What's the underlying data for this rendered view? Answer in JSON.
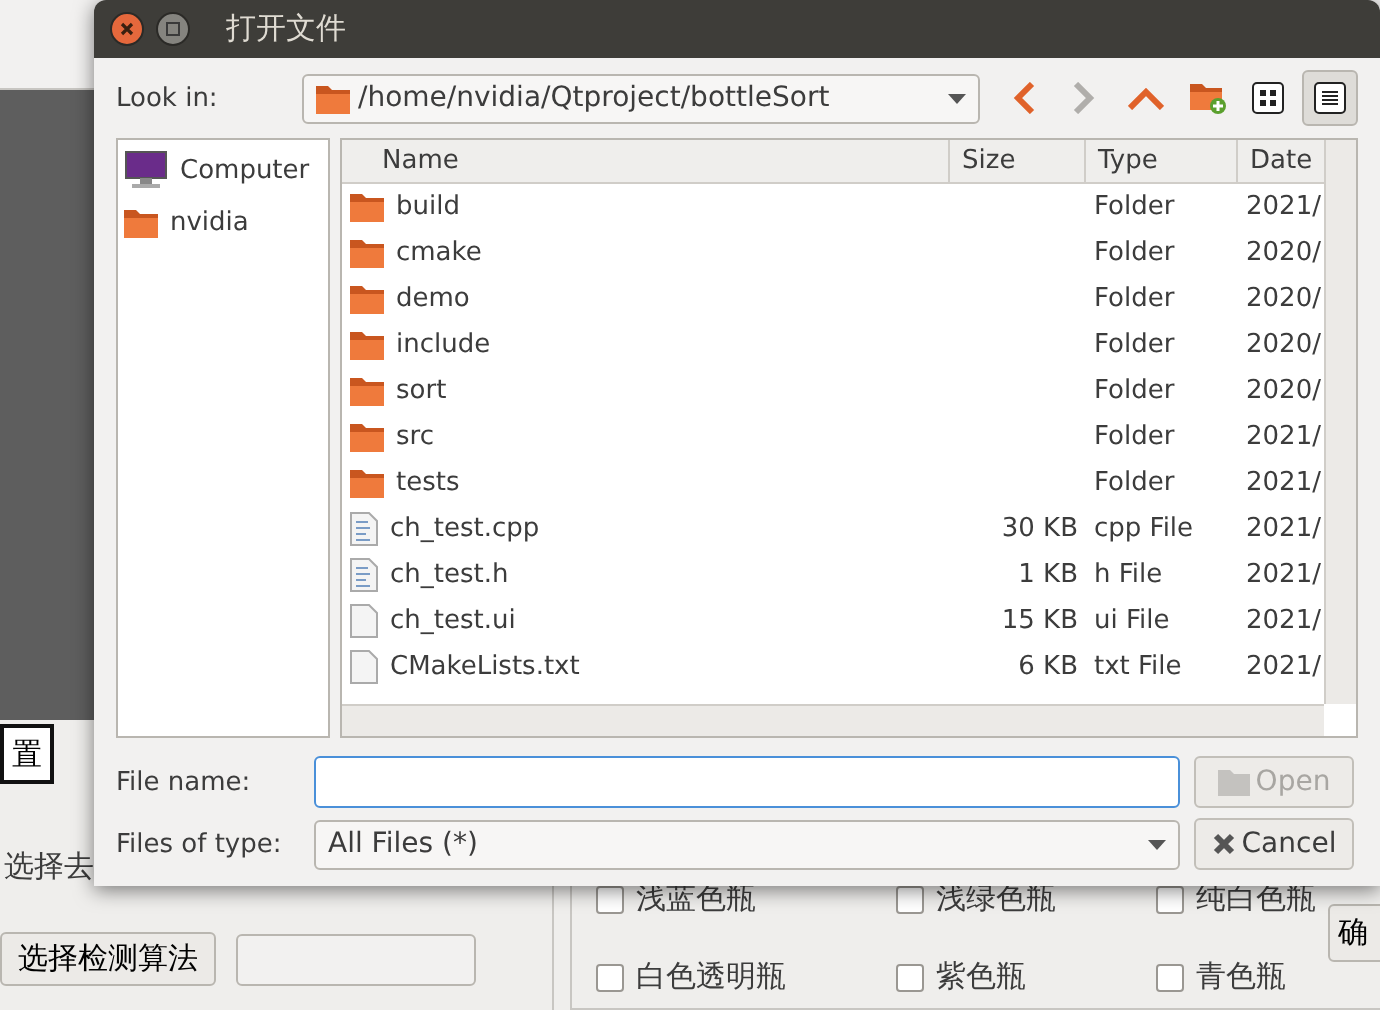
{
  "background": {
    "settings_button": "置",
    "option_label": "选择去",
    "detect_button": "选择检测算法",
    "checkboxes": [
      {
        "label": "浅蓝色瓶",
        "checked": false
      },
      {
        "label": "浅绿色瓶",
        "checked": false
      },
      {
        "label": "纯白色瓶",
        "checked": false
      },
      {
        "label": "白色透明瓶",
        "checked": false
      },
      {
        "label": "紫色瓶",
        "checked": false
      },
      {
        "label": "青色瓶",
        "checked": false
      }
    ],
    "confirm_button": "确"
  },
  "dialog": {
    "title": "打开文件",
    "look_in": {
      "label": "Look in:",
      "path": "/home/nvidia/Qtproject/bottleSort"
    },
    "toolbar": [
      {
        "kind": "back",
        "disabled": false
      },
      {
        "kind": "forward",
        "disabled": true
      },
      {
        "kind": "up"
      },
      {
        "kind": "new-folder"
      },
      {
        "kind": "icon-view",
        "selected": false
      },
      {
        "kind": "detail-view",
        "selected": true
      }
    ],
    "places": [
      {
        "kind": "computer",
        "label": "Computer"
      },
      {
        "kind": "folder",
        "label": "nvidia"
      }
    ],
    "columns": [
      "Name",
      "Size",
      "Type",
      "Date"
    ],
    "rows": [
      {
        "kind": "folder",
        "name": "build",
        "type": "Folder",
        "date": "2021/"
      },
      {
        "kind": "folder",
        "name": "cmake",
        "type": "Folder",
        "date": "2020/"
      },
      {
        "kind": "folder",
        "name": "demo",
        "type": "Folder",
        "date": "2020/"
      },
      {
        "kind": "folder",
        "name": "include",
        "type": "Folder",
        "date": "2020/"
      },
      {
        "kind": "folder",
        "name": "sort",
        "type": "Folder",
        "date": "2020/"
      },
      {
        "kind": "folder",
        "name": "src",
        "type": "Folder",
        "date": "2021/"
      },
      {
        "kind": "folder",
        "name": "tests",
        "type": "Folder",
        "date": "2021/"
      },
      {
        "kind": "source",
        "name": "ch_test.cpp",
        "size": "30 KB",
        "type": "cpp File",
        "date": "2021/"
      },
      {
        "kind": "source",
        "name": "ch_test.h",
        "size": "1 KB",
        "type": "h File",
        "date": "2021/"
      },
      {
        "kind": "file",
        "name": "ch_test.ui",
        "size": "15 KB",
        "type": "ui File",
        "date": "2021/"
      },
      {
        "kind": "file",
        "name": "CMakeLists.txt",
        "size": "6 KB",
        "type": "txt File",
        "date": "2021/"
      }
    ],
    "file_name": {
      "label": "File name:"
    },
    "open_button": {
      "label": "Open",
      "disabled": true
    },
    "file_type": {
      "label": "Files of type:",
      "value": "All Files (*)"
    },
    "cancel_button": {
      "label": "Cancel"
    }
  }
}
